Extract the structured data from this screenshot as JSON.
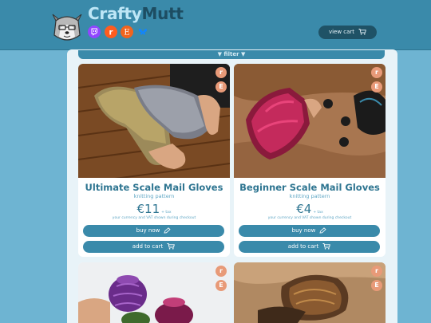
{
  "brand": {
    "part1": "Crafty",
    "part2": "Mutt"
  },
  "social": [
    {
      "icon": "twitch-icon",
      "color": "#9146ff"
    },
    {
      "icon": "reddit-icon",
      "color": "#ff5c1f"
    },
    {
      "icon": "etsy-icon",
      "color": "#f1641e"
    },
    {
      "icon": "bluesky-icon",
      "color": "#1185fe"
    }
  ],
  "header": {
    "view_cart": "view cart"
  },
  "filter": {
    "label": "▼ filter ▼"
  },
  "colors": {
    "header_bg": "#3a8aaa",
    "page_bg": "#6eb4d2",
    "accent": "#2e7591",
    "badge": "#e89a78"
  },
  "products": [
    {
      "title": "Ultimate Scale Mail Gloves",
      "subtitle": "knitting pattern",
      "price": "€11",
      "tax": "+ tax",
      "note": "your currency and VAT shown during checkout",
      "buy_label": "buy now",
      "cart_label": "add to cart",
      "badges": [
        "r",
        "E"
      ]
    },
    {
      "title": "Beginner Scale Mail Gloves",
      "subtitle": "knitting pattern",
      "price": "€4",
      "tax": "+ tax",
      "note": "your currency and VAT shown during checkout",
      "buy_label": "buy now",
      "cart_label": "add to cart",
      "badges": [
        "r",
        "E"
      ]
    },
    {
      "badges": [
        "r",
        "E"
      ]
    },
    {
      "badges": [
        "r",
        "E"
      ]
    }
  ]
}
